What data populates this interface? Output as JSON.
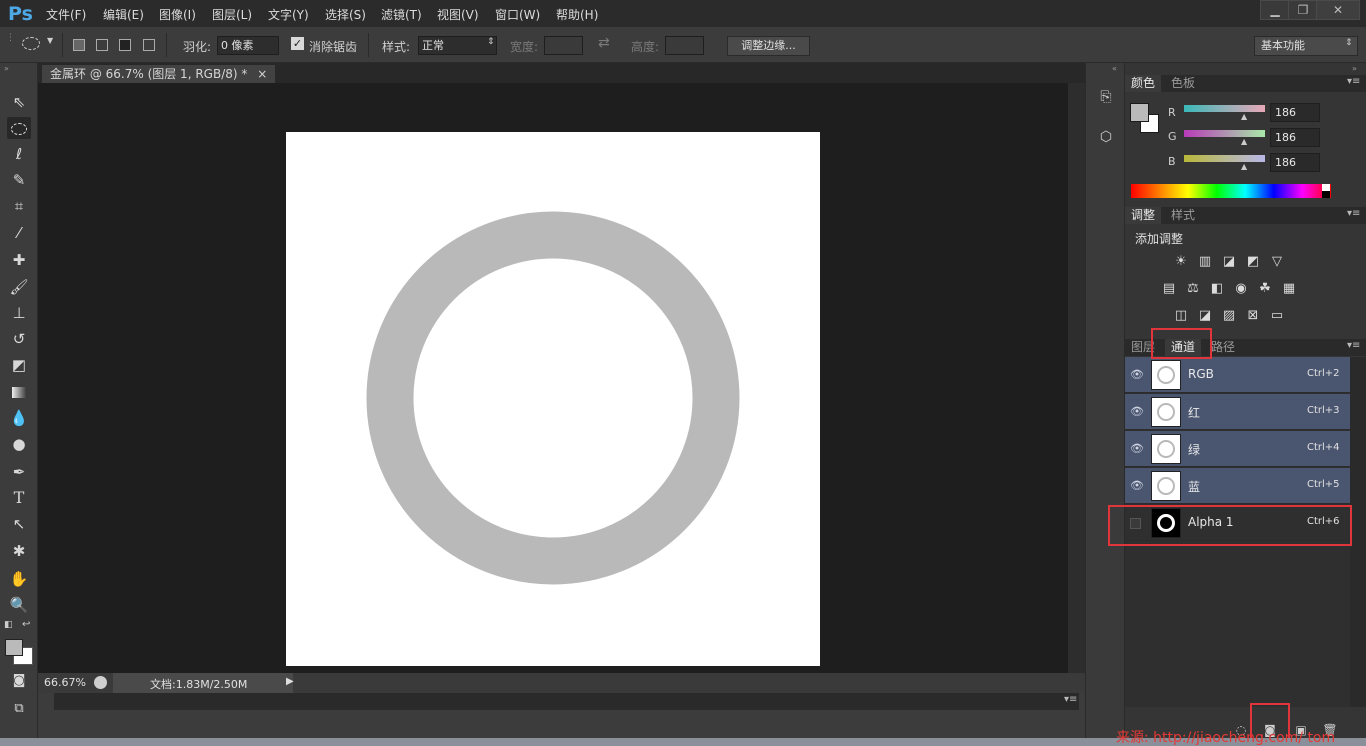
{
  "app": {
    "logo": "Ps"
  },
  "menu": [
    "文件(F)",
    "编辑(E)",
    "图像(I)",
    "图层(L)",
    "文字(Y)",
    "选择(S)",
    "滤镜(T)",
    "视图(V)",
    "窗口(W)",
    "帮助(H)"
  ],
  "window_controls": {
    "minimize": "▁",
    "restore": "❐",
    "close": "✕"
  },
  "options": {
    "feather_label": "羽化:",
    "feather_value": "0 像素",
    "antialias_label": "消除锯齿",
    "antialias_checked": true,
    "style_label": "样式:",
    "style_value": "正常",
    "width_label": "宽度:",
    "height_label": "高度:",
    "refine_edge": "调整边缘...",
    "workspace": "基本功能"
  },
  "document": {
    "tab_title": "金属环 @ 66.7% (图层 1, RGB/8) *",
    "close": "×",
    "zoom": "66.67%",
    "doc_info": "文档:1.83M/2.50M",
    "ring_color": "#b9b9b9"
  },
  "tools": [
    "move-icon",
    "elliptical-marquee-icon",
    "lasso-icon",
    "quick-selection-icon",
    "crop-icon",
    "eyedropper-icon",
    "healing-brush-icon",
    "brush-icon",
    "clone-stamp-icon",
    "history-brush-icon",
    "eraser-icon",
    "gradient-icon",
    "blur-icon",
    "dodge-icon",
    "pen-icon",
    "type-icon",
    "path-selection-icon",
    "shape-icon",
    "hand-icon",
    "zoom-icon"
  ],
  "color_panel": {
    "tabs": [
      "颜色",
      "色板"
    ],
    "r_label": "R",
    "g_label": "G",
    "b_label": "B",
    "r": "186",
    "g": "186",
    "b": "186",
    "fg_color": "#bababa"
  },
  "adjust_panel": {
    "tabs": [
      "调整",
      "样式"
    ],
    "title": "添加调整"
  },
  "layers_panel": {
    "tabs": [
      "图层",
      "通道",
      "路径"
    ],
    "active_tab": "通道",
    "channels": [
      {
        "name": "RGB",
        "shortcut": "Ctrl+2",
        "visible": true
      },
      {
        "name": "红",
        "shortcut": "Ctrl+3",
        "visible": true
      },
      {
        "name": "绿",
        "shortcut": "Ctrl+4",
        "visible": true
      },
      {
        "name": "蓝",
        "shortcut": "Ctrl+5",
        "visible": true
      },
      {
        "name": "Alpha 1",
        "shortcut": "Ctrl+6",
        "visible": false
      }
    ]
  },
  "watermark": "来源: http://jiaocheng.com/ tom"
}
